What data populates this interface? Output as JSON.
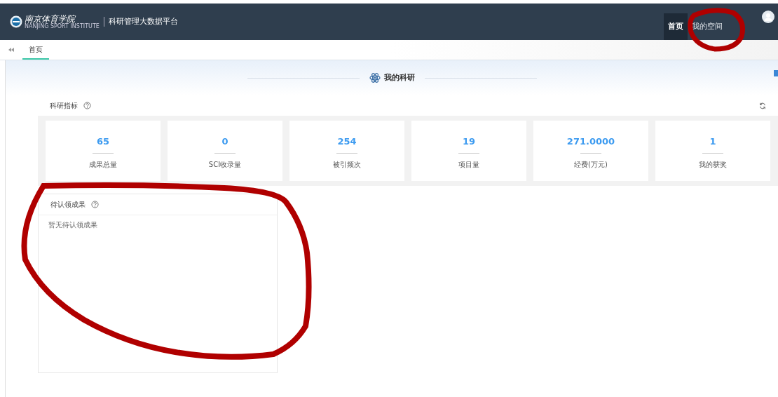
{
  "header": {
    "logo": {
      "name": "南京体育学院",
      "subtitle": "NANJING SPORT INSTITUTE"
    },
    "platform_title": "科研管理大数据平台",
    "nav": [
      {
        "label": "首页",
        "selected": true
      },
      {
        "label": "我的空间",
        "selected": false
      }
    ]
  },
  "tabs": [
    {
      "label": "首页",
      "selected": true
    }
  ],
  "section_title": "我的科研",
  "metrics_panel": {
    "title": "科研指标",
    "items": [
      {
        "value": "65",
        "label": "成果总量"
      },
      {
        "value": "0",
        "label": "SCI收录量"
      },
      {
        "value": "254",
        "label": "被引频次"
      },
      {
        "value": "19",
        "label": "项目量"
      },
      {
        "value": "271.0000",
        "label": "经费(万元)"
      },
      {
        "value": "1",
        "label": "我的获奖"
      }
    ]
  },
  "pending_panel": {
    "title": "待认领成果",
    "empty_text": "暂无待认领成果"
  }
}
